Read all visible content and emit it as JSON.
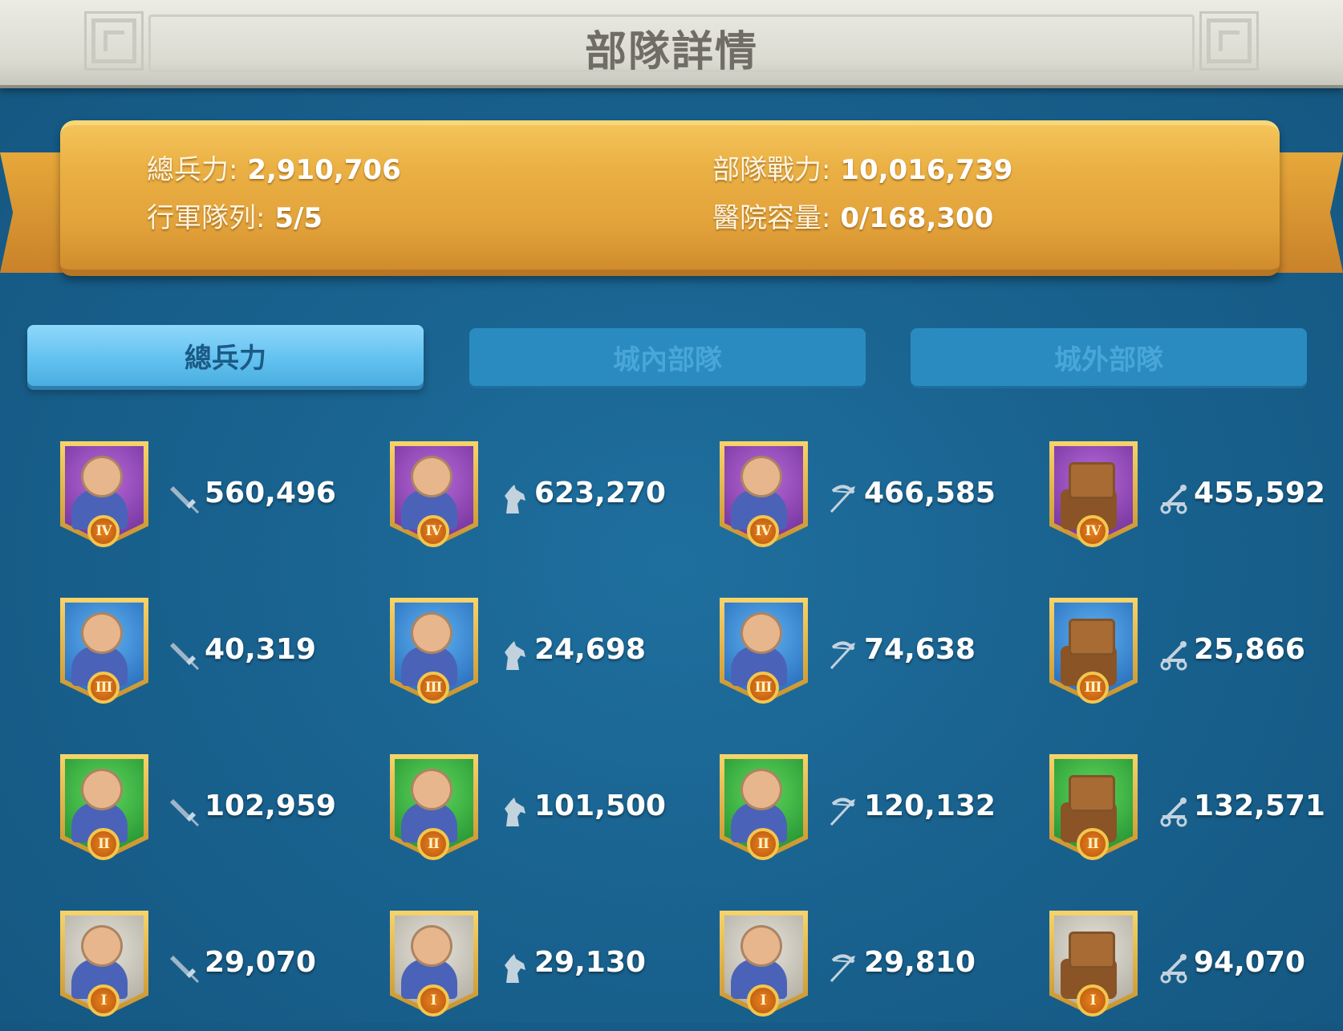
{
  "header": {
    "title": "部隊詳情"
  },
  "summary": {
    "total_troops_label": "總兵力:",
    "total_troops_value": "2,910,706",
    "power_label": "部隊戰力:",
    "power_value": "10,016,739",
    "march_label": "行軍隊列:",
    "march_value": "5/5",
    "hospital_label": "醫院容量:",
    "hospital_value": "0/168,300"
  },
  "tabs": [
    {
      "label": "總兵力",
      "active": true
    },
    {
      "label": "城內部隊",
      "active": false
    },
    {
      "label": "城外部隊",
      "active": false
    }
  ],
  "colors": {
    "tier4": "#7b3aa3",
    "tier3": "#2a72c4",
    "tier2": "#2a9a3a",
    "tier1": "#bdb9ae",
    "banner": "#e6a83f",
    "active_tab": "#63c2f0"
  },
  "troops": [
    [
      {
        "type": "infantry",
        "tier": "IV",
        "count": "560,496",
        "icon": "sword-icon"
      },
      {
        "type": "cavalry",
        "tier": "IV",
        "count": "623,270",
        "icon": "horse-icon"
      },
      {
        "type": "archer",
        "tier": "IV",
        "count": "466,585",
        "icon": "bow-icon"
      },
      {
        "type": "siege",
        "tier": "IV",
        "count": "455,592",
        "icon": "catapult-icon"
      }
    ],
    [
      {
        "type": "infantry",
        "tier": "III",
        "count": "40,319",
        "icon": "sword-icon"
      },
      {
        "type": "cavalry",
        "tier": "III",
        "count": "24,698",
        "icon": "horse-icon"
      },
      {
        "type": "archer",
        "tier": "III",
        "count": "74,638",
        "icon": "bow-icon"
      },
      {
        "type": "siege",
        "tier": "III",
        "count": "25,866",
        "icon": "catapult-icon"
      }
    ],
    [
      {
        "type": "infantry",
        "tier": "II",
        "count": "102,959",
        "icon": "sword-icon"
      },
      {
        "type": "cavalry",
        "tier": "II",
        "count": "101,500",
        "icon": "horse-icon"
      },
      {
        "type": "archer",
        "tier": "II",
        "count": "120,132",
        "icon": "bow-icon"
      },
      {
        "type": "siege",
        "tier": "II",
        "count": "132,571",
        "icon": "catapult-icon"
      }
    ],
    [
      {
        "type": "infantry",
        "tier": "I",
        "count": "29,070",
        "icon": "sword-icon"
      },
      {
        "type": "cavalry",
        "tier": "I",
        "count": "29,130",
        "icon": "horse-icon"
      },
      {
        "type": "archer",
        "tier": "I",
        "count": "29,810",
        "icon": "bow-icon"
      },
      {
        "type": "siege",
        "tier": "I",
        "count": "94,070",
        "icon": "catapult-icon"
      }
    ]
  ]
}
